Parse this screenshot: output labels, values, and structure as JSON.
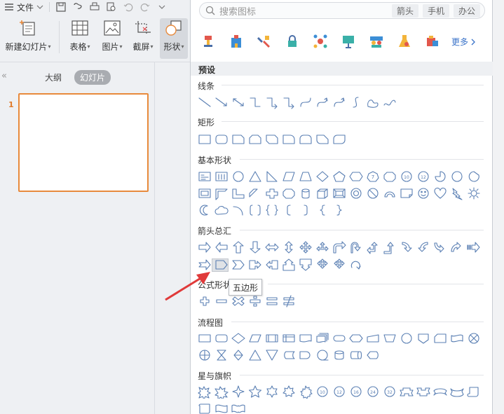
{
  "app": {
    "file_menu": "文件",
    "ribbon": {
      "new_slide": "新建幻灯片",
      "table": "表格",
      "picture": "图片",
      "screenshot": "截屏",
      "shape": "形状"
    }
  },
  "left_panel": {
    "tab_outline": "大纲",
    "tab_slides": "幻灯片",
    "slide_number": "1"
  },
  "shapes_panel": {
    "search_placeholder": "搜索图标",
    "tags": [
      "箭头",
      "手机",
      "办公"
    ],
    "more_label": "更多",
    "preset_label": "预设",
    "sections": {
      "lines": "线条",
      "rectangles": "矩形",
      "basic": "基本形状",
      "arrows": "箭头总汇",
      "equation": "公式形状",
      "flowchart": "流程图",
      "stars": "星与旗帜"
    },
    "tooltip": "五边形"
  },
  "colors": {
    "accent": "#e88a3c",
    "shape_stroke": "#5a7fb3",
    "arrow_annotation": "#e03a3a",
    "link": "#3a73c9"
  }
}
